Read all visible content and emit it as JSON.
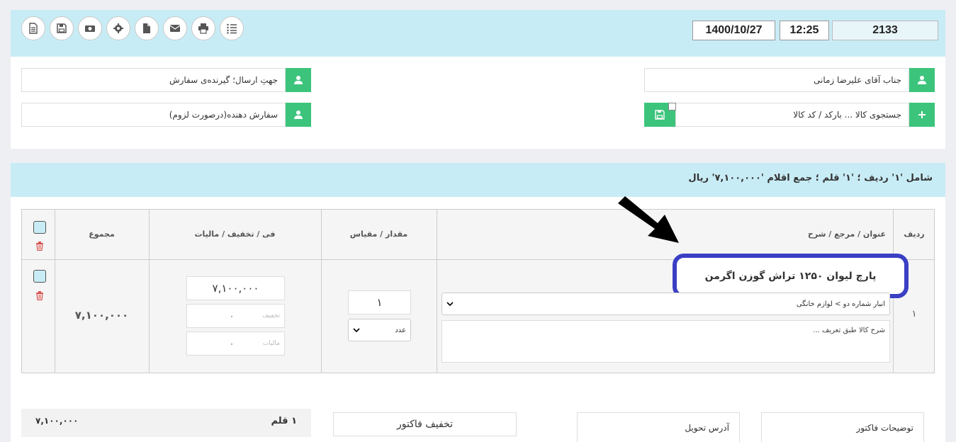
{
  "header": {
    "date": "1400/10/27",
    "time": "12:25",
    "invoice_number": "2133"
  },
  "toolbar": {
    "icons": [
      "doc-text-icon",
      "save-icon",
      "money-icon",
      "gear-icon",
      "file-icon",
      "mail-icon",
      "print-icon",
      "list-icon"
    ]
  },
  "fields": {
    "customer": "جناب آقای علیرضا زمانی",
    "ship_to_placeholder": "جهتِ ارسال؛ گیرنده‌ی سفارش",
    "product_search_placeholder": "جستجوی کالا ... بارکد / کد کالا",
    "orderer_placeholder": "سفارش دهنده(درصورت لزوم)"
  },
  "items_section": {
    "summary": "شامل '۱' ردیف ؛ '۱' قلم ؛ جمع اقلام '۷,۱۰۰,۰۰۰' ریال",
    "columns": {
      "row": "ردیف",
      "title": "عنوان / مرجع / شرح",
      "qty": "مقدار / مقیاس",
      "price": "فی / تخفیف / مالیات",
      "total": "مجموع"
    },
    "rows": [
      {
        "index": "۱",
        "title": "پارچ لیوان ۱۲۵۰ تراش گوزن اگرمن",
        "warehouse": "انبار شماره دو > لوازم خانگی",
        "description_placeholder": "شرح کالا طبق تعریف ...",
        "quantity": "۱",
        "unit": "عدد",
        "price": "۷,۱۰۰,۰۰۰",
        "discount_label": "تخفیف",
        "discount": "۰",
        "tax_label": "مالیات",
        "tax": "۰",
        "total": "۷,۱۰۰,۰۰۰"
      }
    ]
  },
  "footer": {
    "total_items": "۱ قلم",
    "total_amount": "۷,۱۰۰,۰۰۰",
    "invoice_discount": "تخفیف فاکتور",
    "delivery_address": "آدرس تحویل",
    "invoice_notes": "توضیحات فاکتور"
  },
  "colors": {
    "header_bg": "#c8ecf5",
    "accent_green": "#3cc47c",
    "highlight_blue": "#3b3fc4",
    "delete_red": "#d9534f"
  }
}
